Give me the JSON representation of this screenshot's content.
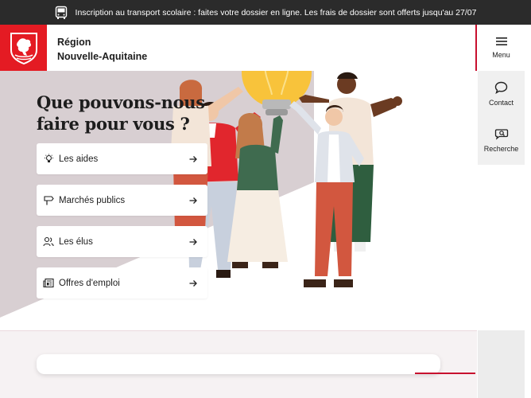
{
  "banner": {
    "icon": "bus-icon",
    "text": "Inscription au transport scolaire : faites votre dossier en ligne. Les frais de dossier sont offerts jusqu'au 27/07"
  },
  "header": {
    "brand_line1": "Région",
    "brand_line2": "Nouvelle-Aquitaine",
    "logo_icon": "lion-crest-icon",
    "accent_color": "#e41b23"
  },
  "sidenav": {
    "items": [
      {
        "label": "Menu",
        "icon": "hamburger-icon"
      },
      {
        "label": "Contact",
        "icon": "speech-bubble-icon"
      },
      {
        "label": "Recherche",
        "icon": "search-bubble-icon"
      }
    ]
  },
  "hero": {
    "title_line1": "Que pouvons-nous",
    "title_line2": "faire pour vous ?",
    "cards": [
      {
        "label": "Les aides",
        "icon": "lightbulb-icon"
      },
      {
        "label": "Marchés publics",
        "icon": "signpost-icon"
      },
      {
        "label": "Les élus",
        "icon": "users-icon"
      },
      {
        "label": "Offres d'emploi",
        "icon": "newspaper-icon"
      }
    ]
  },
  "search": {
    "placeholder": ""
  }
}
